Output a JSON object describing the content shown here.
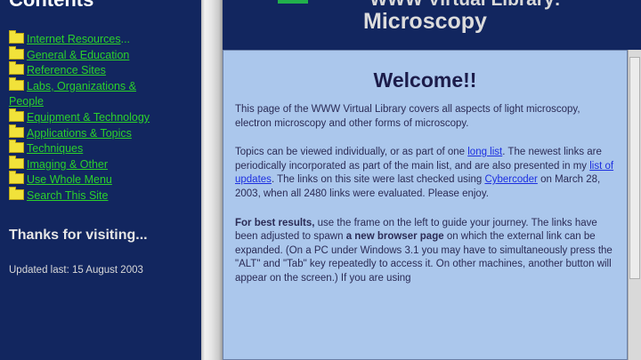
{
  "contents": {
    "heading": "Contents",
    "items": [
      {
        "label": "Internet Resources",
        "suffix": "..."
      },
      {
        "label": "General & Education",
        "suffix": ""
      },
      {
        "label": "Reference Sites",
        "suffix": ""
      },
      {
        "label": "Labs, Organizations &",
        "label2": "People",
        "suffix": ""
      },
      {
        "label": "Equipment & Technology",
        "suffix": ""
      },
      {
        "label": "Applications & Topics",
        "suffix": ""
      },
      {
        "label": "Techniques",
        "suffix": ""
      },
      {
        "label": "Imaging & Other",
        "suffix": ""
      },
      {
        "label": "Use Whole Menu",
        "suffix": ""
      },
      {
        "label": "Search This Site",
        "suffix": ""
      }
    ],
    "thanks": "Thanks for visiting...",
    "updated": "Updated last: 15 August 2003"
  },
  "banner": {
    "title_line1": "WWW Virtual Library:",
    "title_line2": "Microscopy"
  },
  "welcome": {
    "heading": "Welcome!!",
    "p1": "This page of the WWW Virtual Library covers all aspects of light microscopy, electron microscopy and other forms of microscopy.",
    "p2_a": "Topics can be viewed individually, or as part of one ",
    "p2_link1": "long list",
    "p2_b": ". The newest links are periodically incorporated as part of the main list, and are also presented in my ",
    "p2_link2": "list of updates",
    "p2_c": ". The links on this site were last checked using ",
    "p2_link3": "Cybercoder",
    "p2_d": " on March 28, 2003, when all 2480 links were evaluated. Please enjoy.",
    "p3_bold": "For best results,",
    "p3_a": " use the frame on the left to guide your journey. The links have been adjusted to spawn ",
    "p3_bold2": "a new browser page",
    "p3_b": " on which the external link can be expanded. (On a PC under Windows 3.1 you may have to simultaneously press the \"ALT\" and \"Tab\" key repeatedly to access it. On other machines, another button will appear on the screen.) If you are using"
  },
  "colors": {
    "nav_bg": "#12265f",
    "link_green": "#2bd12b",
    "content_bg": "#abc7ec",
    "link_blue": "#1c2fe0"
  }
}
